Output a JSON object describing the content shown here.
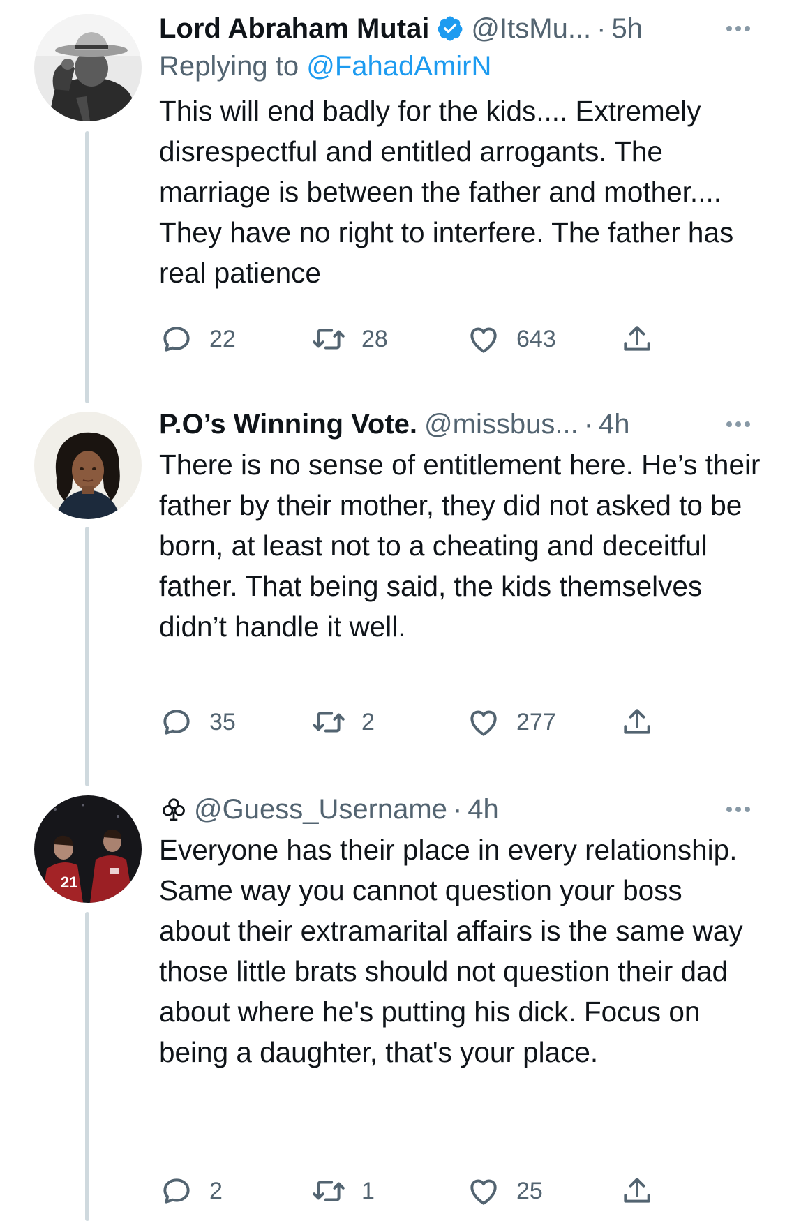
{
  "tweets": [
    {
      "name": "Lord Abraham Mutai",
      "verified": true,
      "handle": "@ItsMu...",
      "time": "5h",
      "replying_prefix": "Replying to ",
      "replying_to": "@FahadAmirN",
      "text": "This will end badly for the kids.... Extremely disrespectful and entitled arrogants. The marriage is between the father and mother.... They have no right to interfere. The father has real patience",
      "replies": "22",
      "retweets": "28",
      "likes": "643",
      "avatar_icon": "avatar-man-hat"
    },
    {
      "name": "P.O’s Winning Vote.",
      "verified": false,
      "handle": "@missbus...",
      "time": "4h",
      "text": "There is no sense of entitlement here. He’s their father by their mother, they did not asked to be born, at least not to a cheating and deceitful father. That being said, the kids themselves didn’t handle it well.",
      "replies": "35",
      "retweets": "2",
      "likes": "277",
      "avatar_icon": "avatar-woman"
    },
    {
      "name": "",
      "name_icon": "club-icon",
      "verified": false,
      "handle": "@Guess_Username",
      "time": "4h",
      "text": "Everyone has their place in every relationship. Same way you cannot question your boss about their extramarital affairs is the same way those little brats should not question their dad about where he's putting his dick. Focus on being a daughter, that's your place.",
      "replies": "2",
      "retweets": "1",
      "likes": "25",
      "avatar_icon": "avatar-football-players"
    }
  ],
  "dot": "·",
  "colors": {
    "text": "#0f1419",
    "secondary": "#536471",
    "link": "#1d9bf0",
    "verified": "#1d9bf0",
    "thread_line": "#cfd9de"
  },
  "icons": {
    "reply": "speech-bubble-icon",
    "retweet": "retweet-icon",
    "like": "heart-icon",
    "share": "share-upload-icon",
    "more": "more-dots-icon"
  }
}
